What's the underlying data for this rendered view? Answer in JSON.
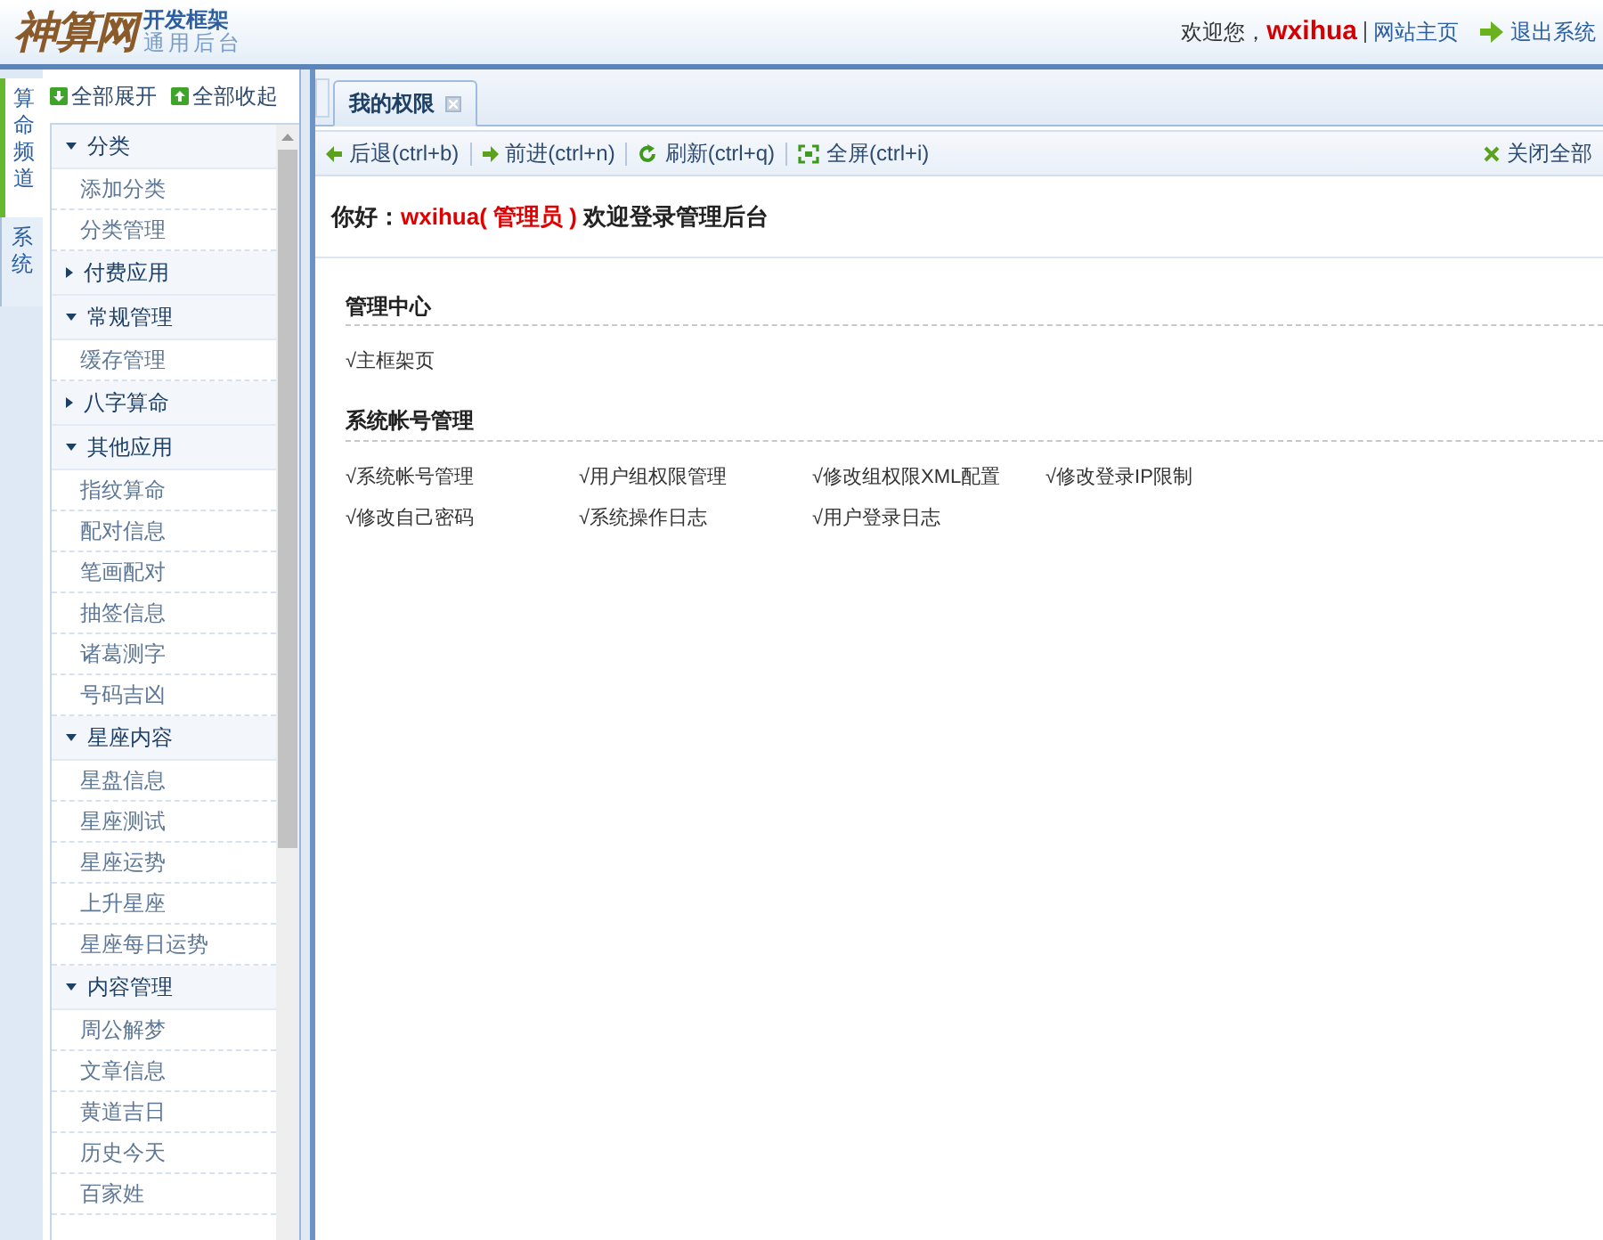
{
  "header": {
    "logo": "神算网",
    "title": "开发框架",
    "subtitle": "通用后台",
    "welcome": "欢迎您，",
    "username": "wxihua",
    "home_link": "网站主页",
    "logout": "退出系统"
  },
  "side_tabs": [
    {
      "label": "算命频道",
      "selected": true
    },
    {
      "label": "系统",
      "selected": false
    }
  ],
  "sidebar": {
    "expand_all": "全部展开",
    "collapse_all": "全部收起",
    "groups": [
      {
        "label": "分类",
        "expanded": true,
        "items": [
          "添加分类",
          "分类管理"
        ]
      },
      {
        "label": "付费应用",
        "expanded": false
      },
      {
        "label": "常规管理",
        "expanded": true,
        "items": [
          "缓存管理"
        ]
      },
      {
        "label": "八字算命",
        "expanded": false
      },
      {
        "label": "其他应用",
        "expanded": true,
        "items": [
          "指纹算命",
          "配对信息",
          "笔画配对",
          "抽签信息",
          "诸葛测字",
          "号码吉凶"
        ]
      },
      {
        "label": "星座内容",
        "expanded": true,
        "items": [
          "星盘信息",
          "星座测试",
          "星座运势",
          "上升星座",
          "星座每日运势"
        ]
      },
      {
        "label": "内容管理",
        "expanded": true,
        "items": [
          "周公解梦",
          "文章信息",
          "黄道吉日",
          "历史今天",
          "百家姓"
        ]
      }
    ]
  },
  "tabs": [
    {
      "label": "我的权限",
      "selected": true
    }
  ],
  "toolbar": {
    "buttons": [
      {
        "kind": "back",
        "label": "后退(ctrl+b)"
      },
      {
        "kind": "forward",
        "label": "前进(ctrl+n)"
      },
      {
        "kind": "refresh",
        "label": "刷新(ctrl+q)"
      },
      {
        "kind": "fullscreen",
        "label": "全屏(ctrl+i)"
      }
    ],
    "close_all": "关闭全部"
  },
  "greeting": {
    "prefix": "你好：",
    "user": "wxihua( 管理员 )",
    "suffix": "欢迎登录管理后台"
  },
  "sections": [
    {
      "title": "管理中心",
      "items": [
        "√主框架页"
      ]
    },
    {
      "title": "系统帐号管理",
      "items": [
        "√系统帐号管理",
        "√用户组权限管理",
        "√修改组权限XML配置",
        "√修改登录IP限制",
        "√修改自己密码",
        "√系统操作日志",
        "√用户登录日志"
      ]
    }
  ]
}
